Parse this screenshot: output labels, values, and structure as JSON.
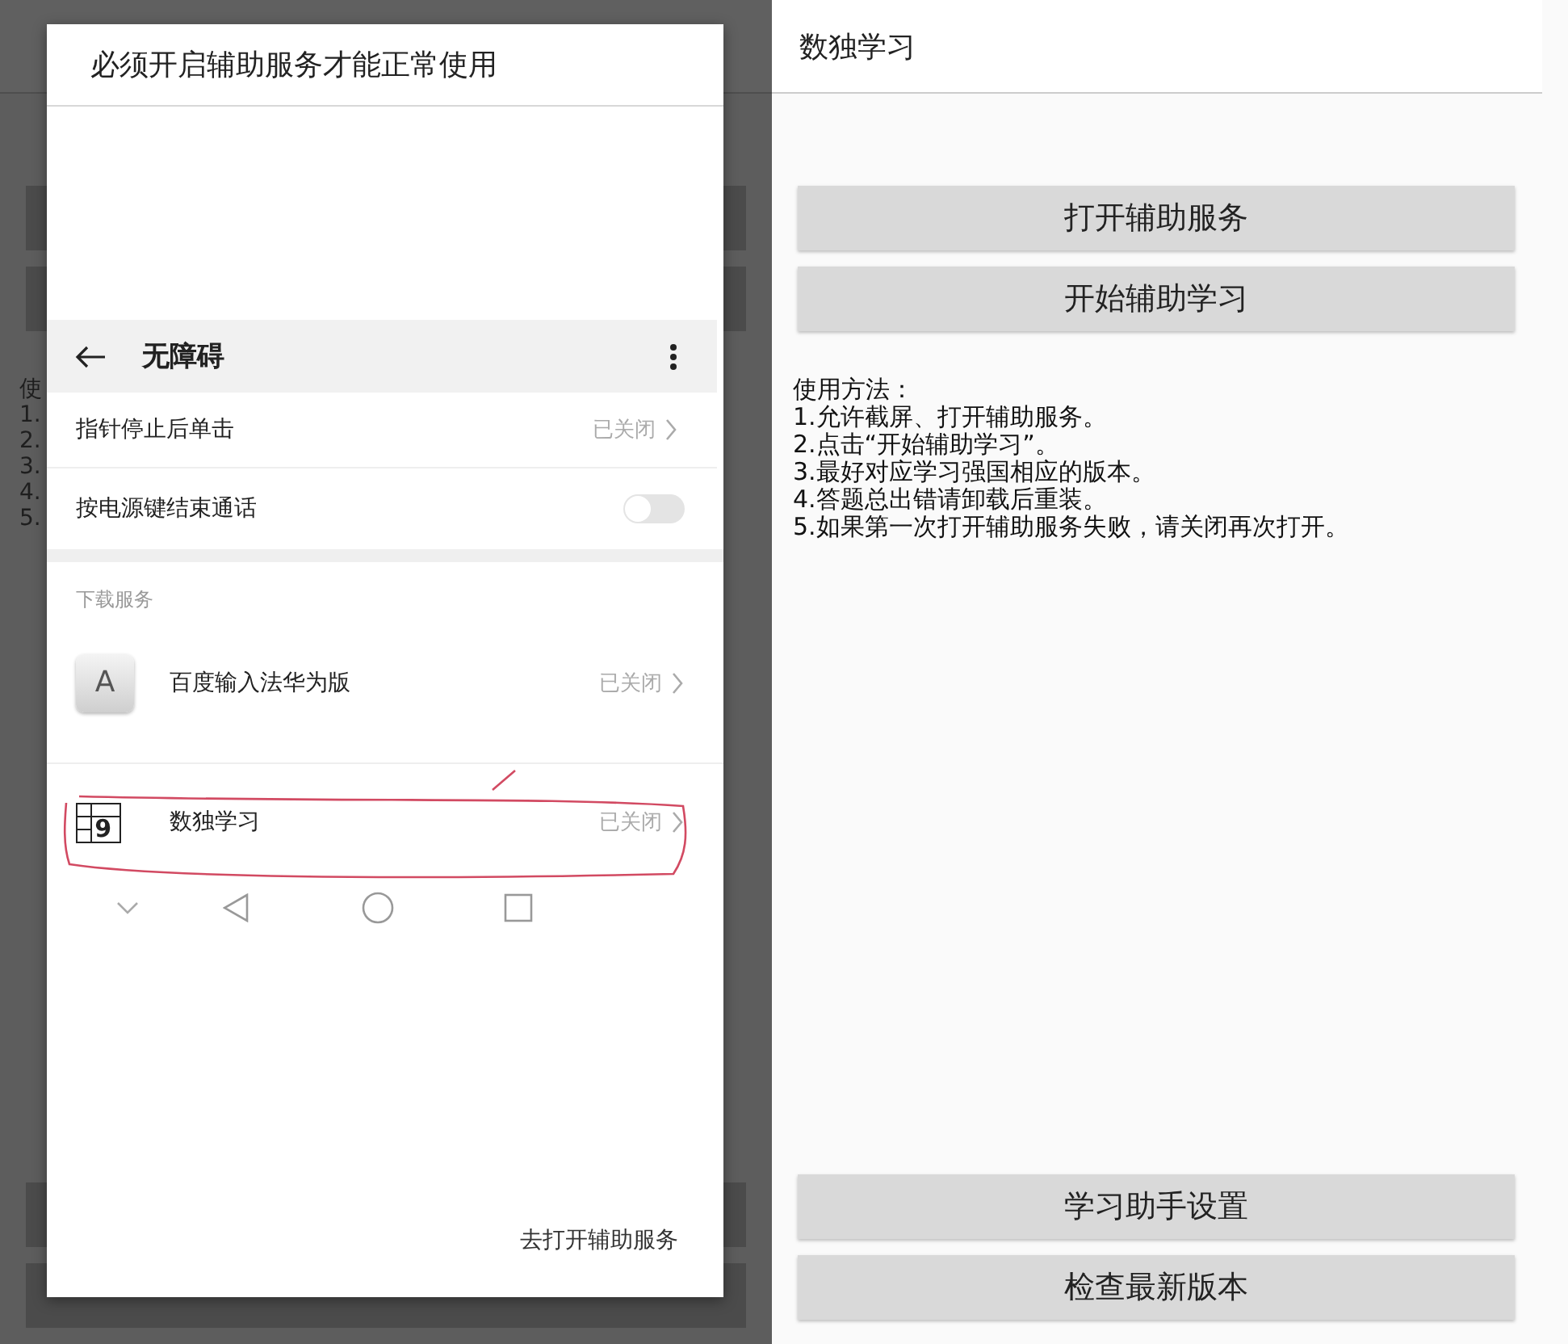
{
  "background_app": {
    "instructions": [
      "使",
      "1.",
      "2.",
      "3.",
      "4.",
      "5."
    ]
  },
  "dialog": {
    "title": "必须开启辅助服务才能正常使用",
    "screenshot": {
      "toolbar_title": "无障碍",
      "rows": [
        {
          "kind": "link",
          "label": "指针停止后单击",
          "value": "已关闭"
        },
        {
          "kind": "switch",
          "label": "按电源键结束通话",
          "on": false
        },
        {
          "kind": "header",
          "label": "下载服务"
        },
        {
          "kind": "letterapp",
          "icon_text": "A",
          "label": "百度输入法华为版",
          "value": "已关闭",
          "highlighted": false
        },
        {
          "kind": "gridapp",
          "icon_text": "9",
          "label": "数独学习",
          "value": "已关闭",
          "highlighted": true
        }
      ]
    },
    "button": "去打开辅助服务"
  },
  "app": {
    "title": "数独学习",
    "top_buttons": [
      "打开辅助服务",
      "开始辅助学习"
    ],
    "instructions": [
      "使用方法：",
      "1.允许截屏、打开辅助服务。",
      "2.点击“开始辅助学习”。",
      "3.最好对应学习强国相应的版本。",
      "4.答题总出错请卸载后重装。",
      "5.如果第一次打开辅助服务失败，请关闭再次打开。"
    ],
    "bottom_buttons": [
      "学习助手设置",
      "检查最新版本"
    ]
  }
}
